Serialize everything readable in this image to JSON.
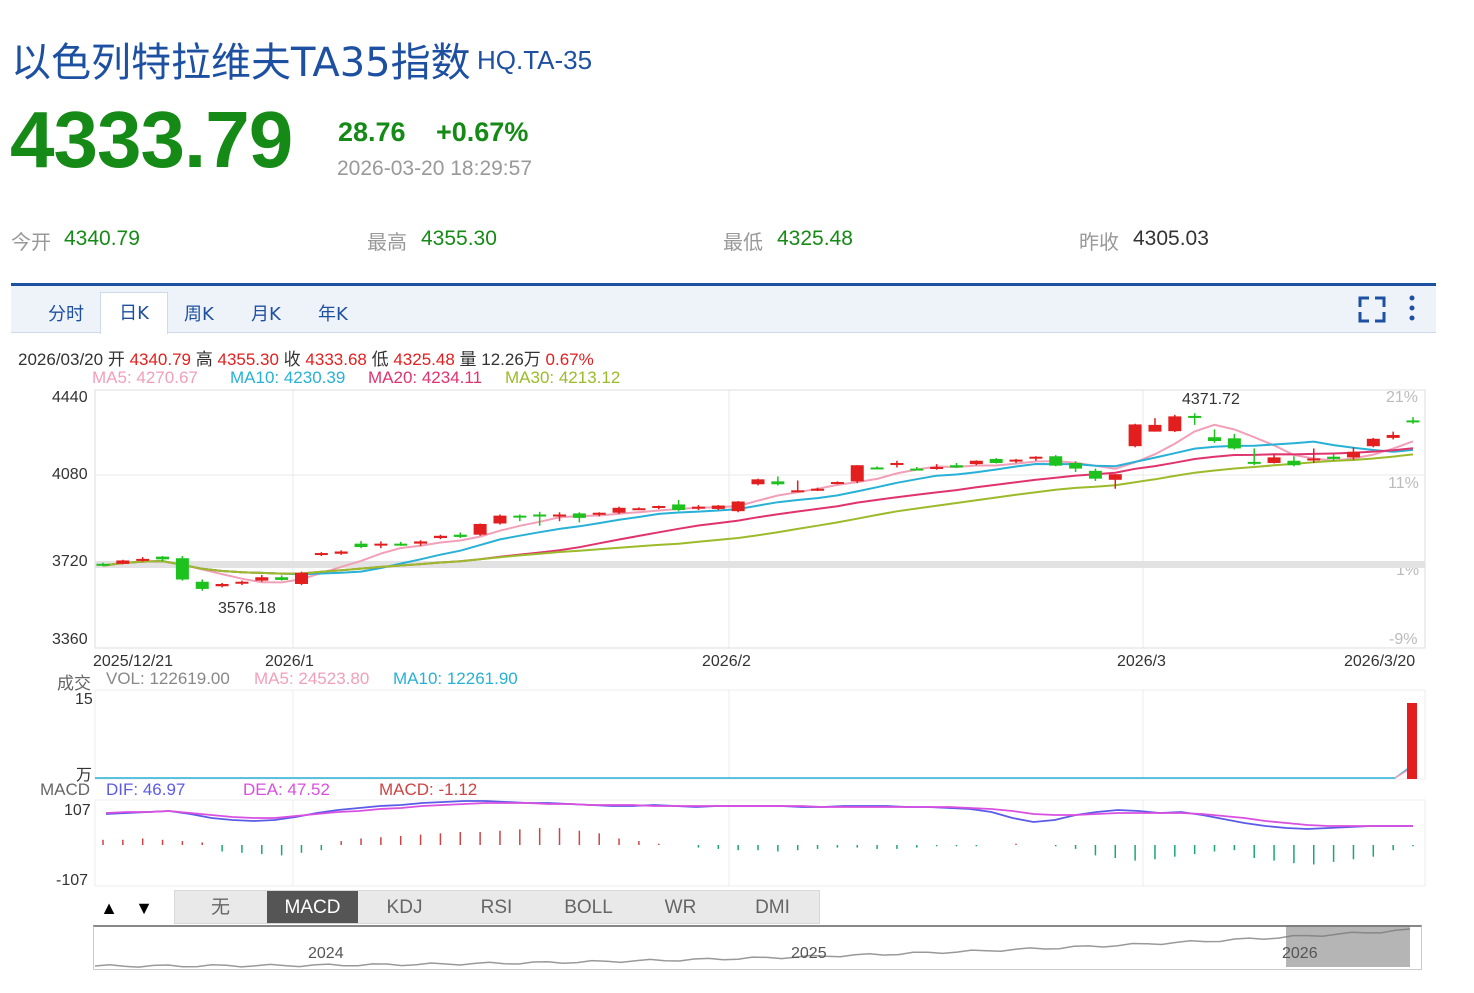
{
  "header": {
    "title": "以色列特拉维夫TA35指数",
    "code": "HQ.TA-35",
    "price": "4333.79",
    "change": "28.76",
    "change_pct": "+0.67%",
    "timestamp": "2026-03-20 18:29:57"
  },
  "quote": {
    "open_label": "今开",
    "open": "4340.79",
    "high_label": "最高",
    "high": "4355.30",
    "low_label": "最低",
    "low": "4325.48",
    "prev_label": "昨收",
    "prev": "4305.03"
  },
  "tabs": [
    "分时",
    "日K",
    "周K",
    "月K",
    "年K"
  ],
  "active_tab": "日K",
  "icons": [
    "fullscreen-icon",
    "more-icon"
  ],
  "info_line": {
    "date": "2026/03/20",
    "open_label": "开",
    "open": "4340.79",
    "high_label": "高",
    "high": "4355.30",
    "close_label": "收",
    "close": "4333.68",
    "low_label": "低",
    "low": "4325.48",
    "vol_label": "量",
    "vol": "12.26万",
    "pct": "0.67%"
  },
  "ma_legend": {
    "ma5": "MA5: 4270.67",
    "ma10": "MA10: 4230.39",
    "ma20": "MA20: 4234.11",
    "ma30": "MA30: 4213.12"
  },
  "vol_legend": {
    "label": "成交",
    "vol": "VOL: 122619.00",
    "ma5": "MA5: 24523.80",
    "ma10": "MA10: 12261.90",
    "axis_top": "15",
    "axis_unit": "万"
  },
  "macd_legend": {
    "label": "MACD",
    "dif": "DIF: 46.97",
    "dea": "DEA: 47.52",
    "macd": "MACD: -1.12",
    "axis_top": "107",
    "axis_bottom": "-107"
  },
  "indicators": [
    "无",
    "MACD",
    "KDJ",
    "RSI",
    "BOLL",
    "WR",
    "DMI"
  ],
  "active_indicator": "MACD",
  "navigator_years": [
    "2024",
    "2025",
    "2026"
  ],
  "colors": {
    "up": "#e21e1e",
    "down": "#1ec21e",
    "ma5": "#f29fb8",
    "ma10": "#27b1d6",
    "ma20": "#e0336e",
    "ma30": "#9bbb2a",
    "brand": "#1e50a2"
  },
  "chart_data": {
    "type": "candlestick",
    "y_ticks": [
      "4440",
      "4080",
      "3720",
      "3360"
    ],
    "y_range": [
      3360,
      4440
    ],
    "pct_ticks": [
      "21%",
      "11%",
      "1%",
      "-9%"
    ],
    "x_ticks": [
      "2025/12/21",
      "2026/1",
      "2026/2",
      "2026/3",
      "2026/3/20"
    ],
    "annotations": {
      "max": "4371.72",
      "min": "3576.18"
    },
    "ohlc": [
      [
        3700,
        3705,
        3690,
        3692
      ],
      [
        3700,
        3718,
        3698,
        3715
      ],
      [
        3718,
        3730,
        3710,
        3722
      ],
      [
        3732,
        3735,
        3710,
        3720
      ],
      [
        3725,
        3735,
        3625,
        3630
      ],
      [
        3620,
        3630,
        3580,
        3588
      ],
      [
        3600,
        3615,
        3595,
        3610
      ],
      [
        3612,
        3625,
        3605,
        3620
      ],
      [
        3625,
        3650,
        3620,
        3640
      ],
      [
        3640,
        3648,
        3625,
        3628
      ],
      [
        3610,
        3665,
        3605,
        3660
      ],
      [
        3740,
        3752,
        3735,
        3748
      ],
      [
        3745,
        3760,
        3740,
        3755
      ],
      [
        3790,
        3802,
        3770,
        3775
      ],
      [
        3788,
        3800,
        3770,
        3790
      ],
      [
        3790,
        3798,
        3780,
        3785
      ],
      [
        3790,
        3805,
        3780,
        3800
      ],
      [
        3815,
        3830,
        3810,
        3825
      ],
      [
        3830,
        3840,
        3815,
        3820
      ],
      [
        3830,
        3880,
        3825,
        3878
      ],
      [
        3880,
        3920,
        3875,
        3915
      ],
      [
        3915,
        3920,
        3890,
        3910
      ],
      [
        3920,
        3932,
        3870,
        3915
      ],
      [
        3918,
        3930,
        3890,
        3920
      ],
      [
        3925,
        3930,
        3885,
        3905
      ],
      [
        3925,
        3930,
        3912,
        3928
      ],
      [
        3928,
        3955,
        3922,
        3950
      ],
      [
        3945,
        3952,
        3940,
        3948
      ],
      [
        3950,
        3960,
        3944,
        3958
      ],
      [
        3965,
        3985,
        3935,
        3940
      ],
      [
        3950,
        3962,
        3940,
        3955
      ],
      [
        3945,
        3962,
        3940,
        3960
      ],
      [
        3935,
        3980,
        3930,
        3978
      ],
      [
        4055,
        4080,
        4050,
        4077
      ],
      [
        4068,
        4090,
        4050,
        4055
      ],
      [
        4025,
        4072,
        4020,
        4028
      ],
      [
        4030,
        4040,
        4025,
        4035
      ],
      [
        4060,
        4068,
        4055,
        4065
      ],
      [
        4068,
        4140,
        4060,
        4140
      ],
      [
        4130,
        4135,
        4122,
        4127
      ],
      [
        4145,
        4160,
        4130,
        4150
      ],
      [
        4125,
        4132,
        4118,
        4122
      ],
      [
        4130,
        4145,
        4120,
        4132
      ],
      [
        4140,
        4150,
        4128,
        4130
      ],
      [
        4145,
        4162,
        4140,
        4160
      ],
      [
        4168,
        4172,
        4148,
        4150
      ],
      [
        4160,
        4168,
        4150,
        4165
      ],
      [
        4172,
        4180,
        4160,
        4178
      ],
      [
        4180,
        4185,
        4135,
        4138
      ],
      [
        4150,
        4158,
        4110,
        4125
      ],
      [
        4115,
        4125,
        4070,
        4080
      ],
      [
        4075,
        4100,
        4035,
        4100
      ],
      [
        4225,
        4325,
        4220,
        4322
      ],
      [
        4290,
        4350,
        4290,
        4320
      ],
      [
        4292,
        4365,
        4288,
        4358
      ],
      [
        4360,
        4372,
        4320,
        4355
      ],
      [
        4265,
        4300,
        4240,
        4248
      ],
      [
        4260,
        4280,
        4210,
        4215
      ],
      [
        4155,
        4215,
        4140,
        4150
      ],
      [
        4150,
        4190,
        4148,
        4175
      ],
      [
        4160,
        4180,
        4135,
        4140
      ],
      [
        4170,
        4215,
        4150,
        4170
      ],
      [
        4178,
        4190,
        4160,
        4168
      ],
      [
        4175,
        4220,
        4165,
        4200
      ],
      [
        4225,
        4262,
        4220,
        4258
      ],
      [
        4262,
        4290,
        4255,
        4275
      ],
      [
        4340,
        4355,
        4325,
        4333
      ]
    ]
  }
}
